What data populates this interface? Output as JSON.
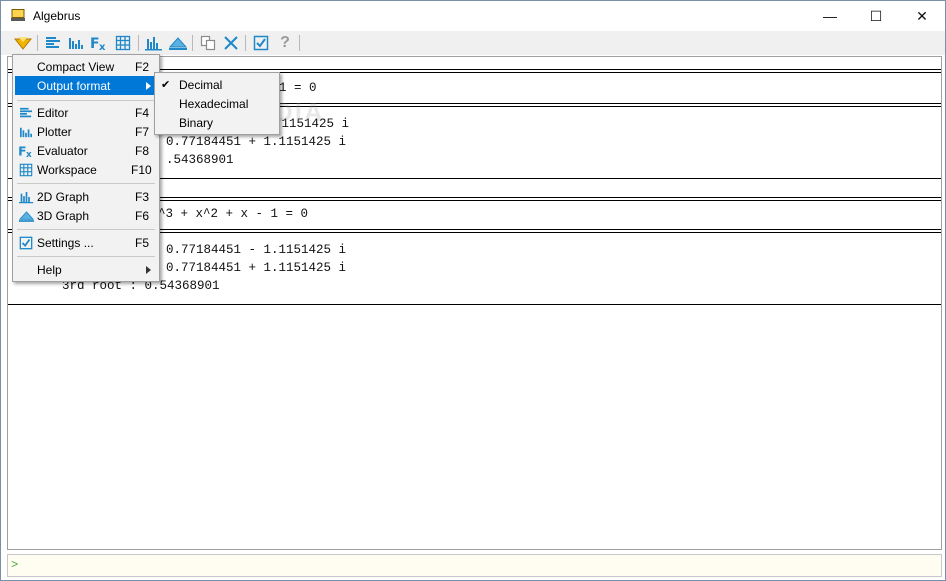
{
  "window": {
    "title": "Algebrus",
    "controls": {
      "minimize": "—",
      "maximize": "☐",
      "close": "✕"
    }
  },
  "toolbar": {
    "buttons": [
      "menu-icon",
      "editor-icon",
      "plotter-icon",
      "evaluator-icon",
      "workspace-icon",
      "graph-2d-icon",
      "graph-3d-icon",
      "copy-icon",
      "clear-icon",
      "settings-icon",
      "help-icon"
    ],
    "help_label": "?"
  },
  "main_menu": {
    "items": [
      {
        "label": "Compact View",
        "key": "F2",
        "icon": ""
      },
      {
        "label": "Output format",
        "key": "",
        "icon": "",
        "submenu": true,
        "highlighted": true
      },
      {
        "label": "Editor",
        "key": "F4",
        "icon": "editor-icon"
      },
      {
        "label": "Plotter",
        "key": "F7",
        "icon": "plotter-icon"
      },
      {
        "label": "Evaluator",
        "key": "F8",
        "icon": "evaluator-icon"
      },
      {
        "label": "Workspace",
        "key": "F10",
        "icon": "workspace-icon"
      },
      {
        "label": "2D Graph",
        "key": "F3",
        "icon": "graph-2d-icon"
      },
      {
        "label": "3D Graph",
        "key": "F6",
        "icon": "graph-3d-icon"
      },
      {
        "label": "Settings ...",
        "key": "F5",
        "icon": "settings-icon"
      },
      {
        "label": "Help",
        "key": "",
        "icon": "",
        "submenu": true
      }
    ]
  },
  "output_format_menu": {
    "items": [
      {
        "label": "Decimal",
        "checked": true
      },
      {
        "label": "Hexadecimal",
        "checked": false
      },
      {
        "label": "Binary",
        "checked": false
      }
    ],
    "check_mark": "✔"
  },
  "output": {
    "block1": {
      "equation_fragment": "1 = 0",
      "line1": ".1151425 i",
      "line2": "0.77184451 + 1.1151425 i",
      "line3": ".54368901"
    },
    "block2": {
      "equation_fragment": "^3 + x^2 + x - 1 = 0",
      "line1": "0.77184451 - 1.1151425 i",
      "line2": "0.77184451 + 1.1151425 i",
      "line3": "3rd root : 0.54368901"
    },
    "watermark": "SOFTPEDIA"
  },
  "input": {
    "prompt": ">",
    "value": ""
  },
  "colors": {
    "accent": "#0078d7",
    "icon_blue": "#1e88c8",
    "prompt_green": "#4aa832"
  }
}
